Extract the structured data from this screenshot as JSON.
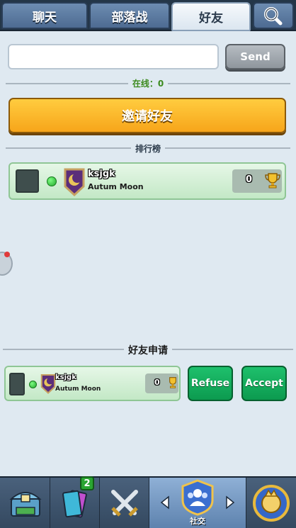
{
  "tabs": [
    {
      "label": "聊天",
      "active": false
    },
    {
      "label": "部落战",
      "active": false
    },
    {
      "label": "好友",
      "active": true
    }
  ],
  "search_icon": "magnifier-icon",
  "message": {
    "value": "",
    "send_label": "Send"
  },
  "online": {
    "label": "在线：0"
  },
  "invite": {
    "label": "邀请好友"
  },
  "leaderboard": {
    "title": "排行榜",
    "friend": {
      "name": "ksjgk",
      "clan": "Autum Moon",
      "trophies": "0",
      "online": true
    }
  },
  "requests": {
    "title": "好友申请",
    "friend": {
      "name": "ksjgk",
      "clan": "Autum Moon",
      "trophies": "0"
    },
    "refuse_label": "Refuse",
    "accept_label": "Accept"
  },
  "bottom_nav": {
    "items": [
      {
        "icon": "chest-icon",
        "active": false
      },
      {
        "icon": "cards-icon",
        "active": false,
        "badge": "2"
      },
      {
        "icon": "crossed-swords-icon",
        "active": false
      },
      {
        "icon": "social-icon",
        "active": true,
        "label": "社交"
      },
      {
        "icon": "tournament-icon",
        "active": false
      }
    ]
  },
  "colors": {
    "accent_orange": "#f7a51a",
    "accept_green": "#0c9a4f",
    "tab_blue": "#5c81ad"
  }
}
